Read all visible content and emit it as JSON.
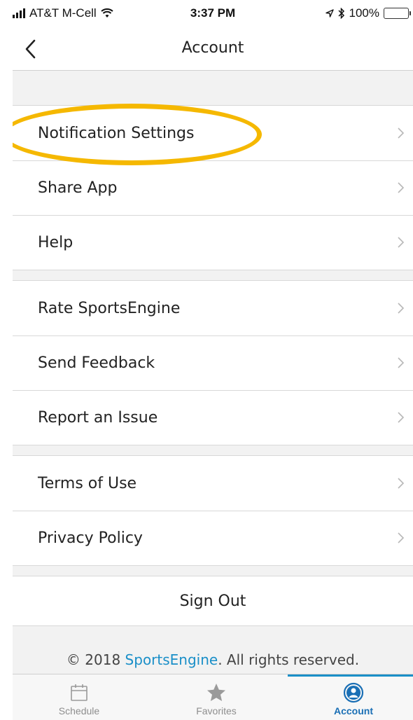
{
  "status_bar": {
    "carrier": "AT&T M-Cell",
    "time": "3:37 PM",
    "battery": "100%",
    "battery_level": 1.0
  },
  "nav": {
    "title": "Account",
    "back_icon": "chevron-left-icon"
  },
  "menu_groups": [
    {
      "items": [
        {
          "label": "Notification Settings"
        },
        {
          "label": "Share App"
        },
        {
          "label": "Help"
        }
      ]
    },
    {
      "items": [
        {
          "label": "Rate SportsEngine"
        },
        {
          "label": "Send Feedback"
        },
        {
          "label": "Report an Issue"
        }
      ]
    },
    {
      "items": [
        {
          "label": "Terms of Use"
        },
        {
          "label": "Privacy Policy"
        }
      ]
    }
  ],
  "sign_out_label": "Sign Out",
  "footer": {
    "prefix": "© 2018 ",
    "brand": "SportsEngine",
    "suffix": ". All rights reserved."
  },
  "tabs": [
    {
      "label": "Schedule",
      "icon": "calendar-icon",
      "active": false
    },
    {
      "label": "Favorites",
      "icon": "star-icon",
      "active": false
    },
    {
      "label": "Account",
      "icon": "account-icon",
      "active": true
    }
  ],
  "colors": {
    "accent": "#1a8fc8",
    "highlight": "#f5b800",
    "battery": "#35c759"
  }
}
